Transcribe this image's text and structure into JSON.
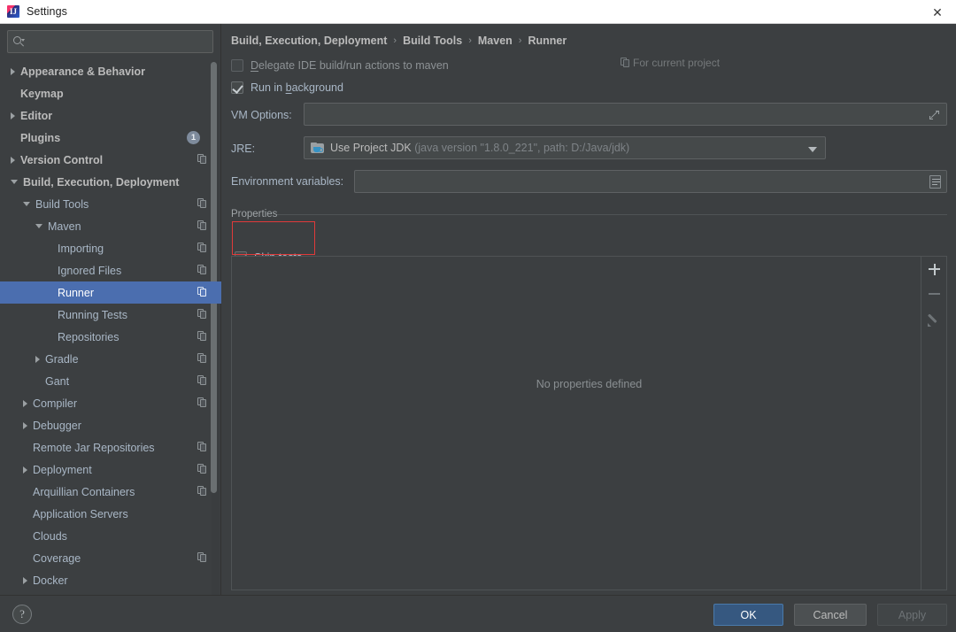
{
  "window": {
    "title": "Settings",
    "app_icon": "intellij-idea-icon",
    "close_label": "✕"
  },
  "search": {
    "value": "",
    "placeholder": "",
    "icon": "search-icon"
  },
  "sidebar": {
    "scrollbar": true,
    "items": [
      {
        "label": "Appearance & Behavior",
        "indent": 0,
        "arrow": "right",
        "top": true,
        "badge": null,
        "copy": false,
        "selected": false
      },
      {
        "label": "Keymap",
        "indent": 0,
        "arrow": "none",
        "top": true,
        "badge": null,
        "copy": false,
        "selected": false
      },
      {
        "label": "Editor",
        "indent": 0,
        "arrow": "right",
        "top": true,
        "badge": null,
        "copy": false,
        "selected": false
      },
      {
        "label": "Plugins",
        "indent": 0,
        "arrow": "none",
        "top": true,
        "badge": "1",
        "copy": false,
        "selected": false
      },
      {
        "label": "Version Control",
        "indent": 0,
        "arrow": "right",
        "top": true,
        "badge": null,
        "copy": true,
        "selected": false
      },
      {
        "label": "Build, Execution, Deployment",
        "indent": 0,
        "arrow": "down",
        "top": true,
        "badge": null,
        "copy": false,
        "selected": false
      },
      {
        "label": "Build Tools",
        "indent": 1,
        "arrow": "down",
        "top": false,
        "badge": null,
        "copy": true,
        "selected": false
      },
      {
        "label": "Maven",
        "indent": 2,
        "arrow": "down",
        "top": false,
        "badge": null,
        "copy": true,
        "selected": false
      },
      {
        "label": "Importing",
        "indent": 3,
        "arrow": "none",
        "top": false,
        "badge": null,
        "copy": true,
        "selected": false
      },
      {
        "label": "Ignored Files",
        "indent": 3,
        "arrow": "none",
        "top": false,
        "badge": null,
        "copy": true,
        "selected": false
      },
      {
        "label": "Runner",
        "indent": 3,
        "arrow": "none",
        "top": false,
        "badge": null,
        "copy": true,
        "selected": true
      },
      {
        "label": "Running Tests",
        "indent": 3,
        "arrow": "none",
        "top": false,
        "badge": null,
        "copy": true,
        "selected": false
      },
      {
        "label": "Repositories",
        "indent": 3,
        "arrow": "none",
        "top": false,
        "badge": null,
        "copy": true,
        "selected": false
      },
      {
        "label": "Gradle",
        "indent": 2,
        "arrow": "right",
        "top": false,
        "badge": null,
        "copy": true,
        "selected": false
      },
      {
        "label": "Gant",
        "indent": 2,
        "arrow": "none",
        "top": false,
        "badge": null,
        "copy": true,
        "selected": false
      },
      {
        "label": "Compiler",
        "indent": 1,
        "arrow": "right",
        "top": false,
        "badge": null,
        "copy": true,
        "selected": false
      },
      {
        "label": "Debugger",
        "indent": 1,
        "arrow": "right",
        "top": false,
        "badge": null,
        "copy": false,
        "selected": false
      },
      {
        "label": "Remote Jar Repositories",
        "indent": 1,
        "arrow": "none",
        "top": false,
        "badge": null,
        "copy": true,
        "selected": false
      },
      {
        "label": "Deployment",
        "indent": 1,
        "arrow": "right",
        "top": false,
        "badge": null,
        "copy": true,
        "selected": false
      },
      {
        "label": "Arquillian Containers",
        "indent": 1,
        "arrow": "none",
        "top": false,
        "badge": null,
        "copy": true,
        "selected": false
      },
      {
        "label": "Application Servers",
        "indent": 1,
        "arrow": "none",
        "top": false,
        "badge": null,
        "copy": false,
        "selected": false
      },
      {
        "label": "Clouds",
        "indent": 1,
        "arrow": "none",
        "top": false,
        "badge": null,
        "copy": false,
        "selected": false
      },
      {
        "label": "Coverage",
        "indent": 1,
        "arrow": "none",
        "top": false,
        "badge": null,
        "copy": true,
        "selected": false
      },
      {
        "label": "Docker",
        "indent": 1,
        "arrow": "right",
        "top": false,
        "badge": null,
        "copy": false,
        "selected": false
      }
    ]
  },
  "main": {
    "breadcrumb": [
      "Build, Execution, Deployment",
      "Build Tools",
      "Maven",
      "Runner"
    ],
    "breadcrumb_separator": "›",
    "for_current_project": {
      "label": "For current project",
      "icon": "copy-settings-icon"
    },
    "checkboxes": [
      {
        "label": "Delegate IDE build/run actions to maven",
        "checked": false,
        "mnemonic": "D"
      },
      {
        "label": "Run in background",
        "checked": true,
        "mnemonic": "b"
      }
    ],
    "vm_options": {
      "label": "VM Options:",
      "value": "",
      "placeholder": "",
      "expand_icon": "expand-icon"
    },
    "jre": {
      "label": "JRE:",
      "selected": "Use Project JDK",
      "detail": "(java version \"1.8.0_221\", path: D:/Java/jdk)",
      "icon": "jdk-folder-icon",
      "arrow_icon": "chevron-down-icon"
    },
    "environment_variables": {
      "label": "Environment variables:",
      "value": "",
      "placeholder": "",
      "browse_icon": "list-browse-icon"
    },
    "properties_group": {
      "title": "Properties",
      "skip_tests": {
        "label": "Skip tests",
        "checked": true,
        "mnemonic": "t"
      },
      "highlight_color": "#e03a3a"
    },
    "properties_table": {
      "empty_text": "No properties defined",
      "toolbar": [
        {
          "name": "add-property-button",
          "icon": "plus-icon",
          "enabled": true
        },
        {
          "name": "remove-property-button",
          "icon": "minus-icon",
          "enabled": false
        },
        {
          "name": "edit-property-button",
          "icon": "pencil-icon",
          "enabled": false
        }
      ]
    }
  },
  "footer": {
    "help_label": "?",
    "ok_label": "OK",
    "cancel_label": "Cancel",
    "apply_label": "Apply",
    "ok_color": "#365880"
  }
}
